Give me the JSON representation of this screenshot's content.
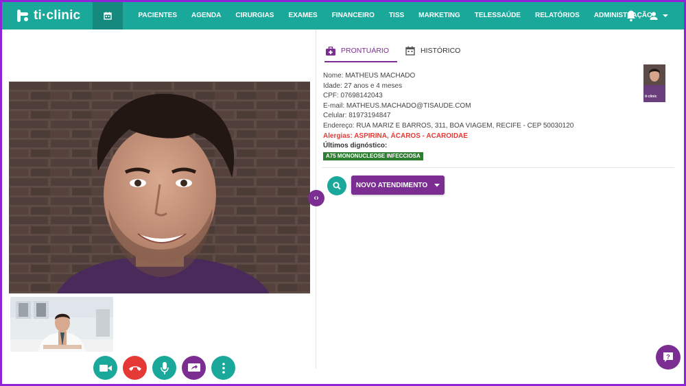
{
  "app": {
    "logo_text": "ti·clinic"
  },
  "nav": {
    "items": [
      "PACIENTES",
      "AGENDA",
      "CIRURGIAS",
      "EXAMES",
      "FINANCEIRO",
      "TISS",
      "MARKETING",
      "TELESSAÚDE",
      "RELATÓRIOS",
      "ADMINISTRAÇÃO"
    ]
  },
  "tabs": {
    "prontuario": "PRONTUÁRIO",
    "historico": "HISTÓRICO"
  },
  "patient": {
    "nome": "Nome: MATHEUS MACHADO",
    "idade": "Idade: 27 anos e 4 meses",
    "cpf": "CPF: 07698142043",
    "email": "E-mail: MATHEUS.MACHADO@TISAUDE.COM",
    "celular": "Celular: 81973194847",
    "endereco": "Endereço: RUA MARIZ E BARROS, 311, BOA VIAGEM, RECIFE - CEP 50030120",
    "alergias": "Alergias: ASPIRINA, ÁCAROS - ACAROIDAE",
    "ultimos_label": "Últimos dignóstico:",
    "diagnostico": "A75 MONONUCLEOSE INFECCIOSA",
    "photo_caption": "ti·clinic"
  },
  "actions": {
    "novo_atendimento": "NOVO ATENDIMENTO"
  },
  "colors": {
    "primary": "#1aa89a",
    "accent": "#7b2d91",
    "danger": "#e53935",
    "frame": "#8e24d6"
  },
  "icons": [
    "calendar-icon",
    "bell-icon",
    "user-icon",
    "medical-bag-icon",
    "history-calendar-icon",
    "search-icon",
    "video-icon",
    "hangup-icon",
    "mic-icon",
    "share-screen-icon",
    "more-icon",
    "help-icon",
    "expand-icon"
  ]
}
